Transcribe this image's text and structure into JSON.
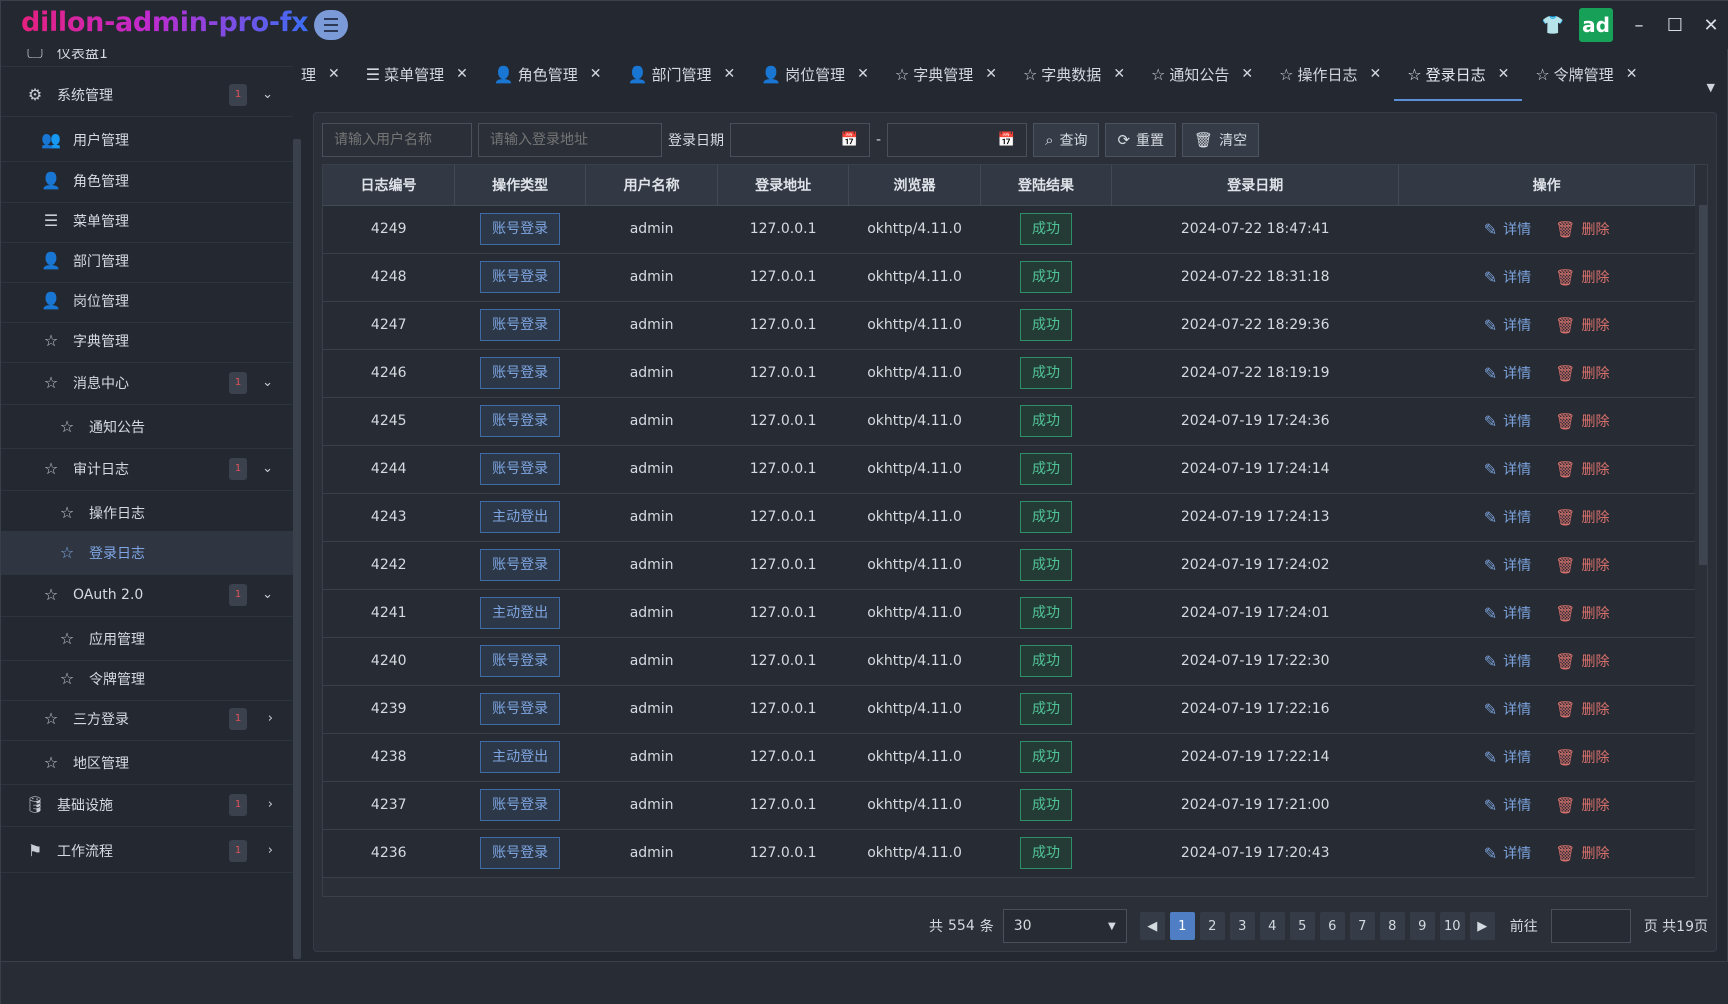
{
  "app": {
    "title": "dillon-admin-pro-fx",
    "avatar": "ad"
  },
  "sidebar": {
    "top_partial": "仪表盘1",
    "items": [
      {
        "label": "系统管理",
        "badge": "1",
        "arrow": "⌵",
        "level": 0,
        "icon": "gear-icon"
      },
      {
        "label": "用户管理",
        "level": 1,
        "icon": "users-icon"
      },
      {
        "label": "角色管理",
        "level": 1,
        "icon": "user-add-icon"
      },
      {
        "label": "菜单管理",
        "level": 1,
        "icon": "list-icon"
      },
      {
        "label": "部门管理",
        "level": 1,
        "icon": "user-add-icon"
      },
      {
        "label": "岗位管理",
        "level": 1,
        "icon": "user-minus-icon"
      },
      {
        "label": "字典管理",
        "level": 1,
        "icon": "star-icon"
      },
      {
        "label": "消息中心",
        "badge": "1",
        "arrow": "⌵",
        "level": 1,
        "icon": "star-icon"
      },
      {
        "label": "通知公告",
        "level": 2,
        "icon": "star-icon"
      },
      {
        "label": "审计日志",
        "badge": "1",
        "arrow": "⌵",
        "level": 1,
        "icon": "star-icon"
      },
      {
        "label": "操作日志",
        "level": 2,
        "icon": "star-icon"
      },
      {
        "label": "登录日志",
        "level": 2,
        "icon": "star-icon",
        "active": true
      },
      {
        "label": "OAuth 2.0",
        "badge": "1",
        "arrow": "⌵",
        "level": 1,
        "icon": "star-icon"
      },
      {
        "label": "应用管理",
        "level": 2,
        "icon": "star-icon"
      },
      {
        "label": "令牌管理",
        "level": 2,
        "icon": "star-icon"
      },
      {
        "label": "三方登录",
        "badge": "1",
        "arrow": "›",
        "level": 1,
        "icon": "star-icon"
      },
      {
        "label": "地区管理",
        "level": 1,
        "icon": "star-icon"
      },
      {
        "label": "基础设施",
        "badge": "1",
        "arrow": "›",
        "level": 0,
        "icon": "database-icon"
      },
      {
        "label": "工作流程",
        "badge": "1",
        "arrow": "›",
        "level": 0,
        "icon": "flag-icon"
      }
    ]
  },
  "tabs": [
    {
      "label": "理",
      "icon": ""
    },
    {
      "label": "菜单管理",
      "icon": "☰"
    },
    {
      "label": "角色管理",
      "icon": "👤"
    },
    {
      "label": "部门管理",
      "icon": "👤"
    },
    {
      "label": "岗位管理",
      "icon": "👤"
    },
    {
      "label": "字典管理",
      "icon": "☆"
    },
    {
      "label": "字典数据",
      "icon": "☆"
    },
    {
      "label": "通知公告",
      "icon": "☆"
    },
    {
      "label": "操作日志",
      "icon": "☆"
    },
    {
      "label": "登录日志",
      "icon": "☆",
      "active": true
    },
    {
      "label": "令牌管理",
      "icon": "☆"
    }
  ],
  "filters": {
    "username_placeholder": "请输入用户名称",
    "address_placeholder": "请输入登录地址",
    "date_label": "登录日期",
    "date_sep": "-",
    "query_label": "查询",
    "reset_label": "重置",
    "clear_label": "清空"
  },
  "table": {
    "headers": [
      "日志编号",
      "操作类型",
      "用户名称",
      "登录地址",
      "浏览器",
      "登陆结果",
      "登录日期",
      "操作"
    ],
    "detail_label": "详情",
    "delete_label": "删除",
    "rows": [
      {
        "id": "4249",
        "type": "账号登录",
        "user": "admin",
        "addr": "127.0.0.1",
        "browser": "okhttp/4.11.0",
        "result": "成功",
        "date": "2024-07-22 18:47:41"
      },
      {
        "id": "4248",
        "type": "账号登录",
        "user": "admin",
        "addr": "127.0.0.1",
        "browser": "okhttp/4.11.0",
        "result": "成功",
        "date": "2024-07-22 18:31:18"
      },
      {
        "id": "4247",
        "type": "账号登录",
        "user": "admin",
        "addr": "127.0.0.1",
        "browser": "okhttp/4.11.0",
        "result": "成功",
        "date": "2024-07-22 18:29:36"
      },
      {
        "id": "4246",
        "type": "账号登录",
        "user": "admin",
        "addr": "127.0.0.1",
        "browser": "okhttp/4.11.0",
        "result": "成功",
        "date": "2024-07-22 18:19:19"
      },
      {
        "id": "4245",
        "type": "账号登录",
        "user": "admin",
        "addr": "127.0.0.1",
        "browser": "okhttp/4.11.0",
        "result": "成功",
        "date": "2024-07-19 17:24:36"
      },
      {
        "id": "4244",
        "type": "账号登录",
        "user": "admin",
        "addr": "127.0.0.1",
        "browser": "okhttp/4.11.0",
        "result": "成功",
        "date": "2024-07-19 17:24:14"
      },
      {
        "id": "4243",
        "type": "主动登出",
        "user": "admin",
        "addr": "127.0.0.1",
        "browser": "okhttp/4.11.0",
        "result": "成功",
        "date": "2024-07-19 17:24:13"
      },
      {
        "id": "4242",
        "type": "账号登录",
        "user": "admin",
        "addr": "127.0.0.1",
        "browser": "okhttp/4.11.0",
        "result": "成功",
        "date": "2024-07-19 17:24:02"
      },
      {
        "id": "4241",
        "type": "主动登出",
        "user": "admin",
        "addr": "127.0.0.1",
        "browser": "okhttp/4.11.0",
        "result": "成功",
        "date": "2024-07-19 17:24:01"
      },
      {
        "id": "4240",
        "type": "账号登录",
        "user": "admin",
        "addr": "127.0.0.1",
        "browser": "okhttp/4.11.0",
        "result": "成功",
        "date": "2024-07-19 17:22:30"
      },
      {
        "id": "4239",
        "type": "账号登录",
        "user": "admin",
        "addr": "127.0.0.1",
        "browser": "okhttp/4.11.0",
        "result": "成功",
        "date": "2024-07-19 17:22:16"
      },
      {
        "id": "4238",
        "type": "主动登出",
        "user": "admin",
        "addr": "127.0.0.1",
        "browser": "okhttp/4.11.0",
        "result": "成功",
        "date": "2024-07-19 17:22:14"
      },
      {
        "id": "4237",
        "type": "账号登录",
        "user": "admin",
        "addr": "127.0.0.1",
        "browser": "okhttp/4.11.0",
        "result": "成功",
        "date": "2024-07-19 17:21:00"
      },
      {
        "id": "4236",
        "type": "账号登录",
        "user": "admin",
        "addr": "127.0.0.1",
        "browser": "okhttp/4.11.0",
        "result": "成功",
        "date": "2024-07-19 17:20:43"
      }
    ]
  },
  "pager": {
    "total_prefix": "共",
    "total": "554",
    "total_suffix": "条",
    "page_size": "30",
    "pages": [
      "1",
      "2",
      "3",
      "4",
      "5",
      "6",
      "7",
      "8",
      "9",
      "10"
    ],
    "current": "1",
    "goto_label": "前往",
    "page_suffix": "页 共19页"
  },
  "colors": {
    "accent": "#4f7ec5",
    "success": "#4fc497",
    "danger": "#d9706c",
    "brand_start": "#e6207e",
    "brand_end": "#3b6ef5"
  }
}
